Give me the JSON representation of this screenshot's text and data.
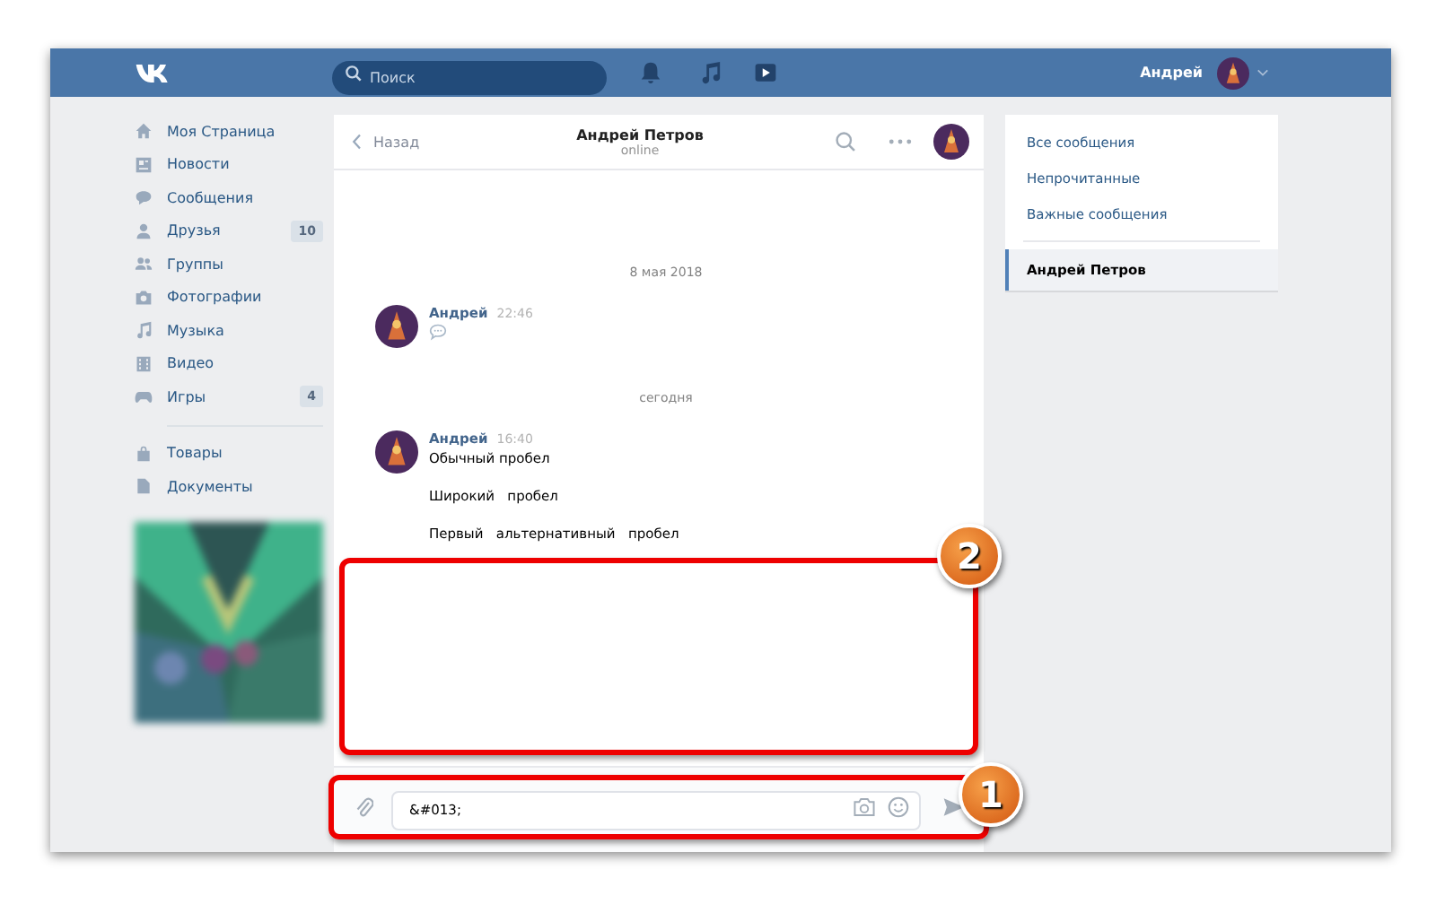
{
  "header": {
    "search": {
      "placeholder": "Поиск"
    },
    "user_name": "Андрей"
  },
  "sidebar": {
    "items": [
      {
        "label": "Моя Страница"
      },
      {
        "label": "Новости"
      },
      {
        "label": "Сообщения"
      },
      {
        "label": "Друзья",
        "count": "10"
      },
      {
        "label": "Группы"
      },
      {
        "label": "Фотографии"
      },
      {
        "label": "Музыка"
      },
      {
        "label": "Видео"
      },
      {
        "label": "Игры",
        "count": "4"
      }
    ],
    "extra_items": [
      {
        "label": "Товары"
      },
      {
        "label": "Документы"
      }
    ]
  },
  "chat": {
    "back": "Назад",
    "title": "Андрей Петров",
    "status": "online",
    "messages": [
      {
        "kind": "date",
        "text": "8 мая 2018"
      },
      {
        "kind": "message",
        "author": "Андрей",
        "time": "22:46",
        "has_icon": true
      },
      {
        "kind": "date",
        "text": "сегодня"
      },
      {
        "kind": "message",
        "author": "Андрей",
        "time": "16:40",
        "has_icon": false,
        "lines": [
          "Обычный пробел",
          "Широкий   пробел",
          "Первый   альтернативный   пробел"
        ]
      }
    ],
    "callout_area": "2",
    "composer": {
      "value": "&#013;",
      "callout": "1"
    }
  },
  "filters": [
    {
      "label": "Все сообщения",
      "selected": false
    },
    {
      "label": "Непрочитанные",
      "selected": false
    },
    {
      "label": "Важные сообщения",
      "selected": false
    }
  ],
  "dialogs": [
    {
      "label": "Андрей Петров",
      "selected": true
    }
  ]
}
